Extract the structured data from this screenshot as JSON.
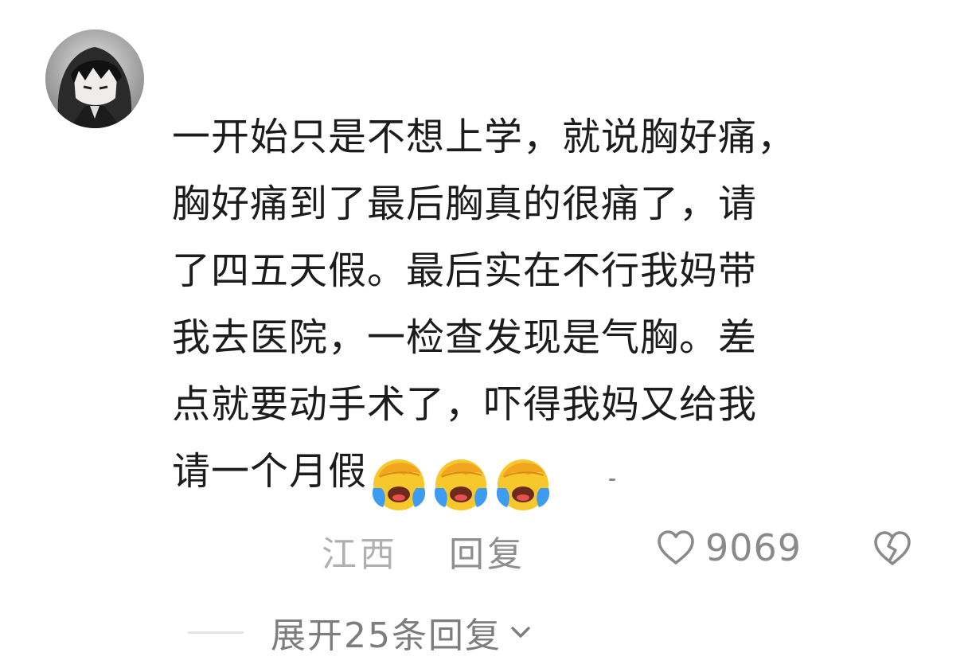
{
  "comment": {
    "lines": [
      "一开始只是不想上学，就说胸好痛，",
      "胸好痛到了最后胸真的很痛了，请",
      "了四五天假。最后实在不行我妈带",
      "我去医院，一检查发现是气胸。差",
      "点就要动手术了，吓得我妈又给我",
      "请一个月假"
    ],
    "emoji": [
      "face-palm-crying-emoji",
      "face-palm-crying-emoji",
      "face-palm-crying-emoji"
    ]
  },
  "meta": {
    "location": "江西",
    "reply_label": "回复",
    "like_count": "9069"
  },
  "expand": {
    "label": "展开25条回复"
  },
  "icons": {
    "like": "heart-outline-icon",
    "dislike": "broken-heart-icon",
    "expand": "chevron-down-icon"
  },
  "colors": {
    "text": "#1c1c1c",
    "muted": "#8a8a8a",
    "location": "#b0b0b0",
    "emoji_face": "#f7c82c",
    "emoji_tears": "#3d9bf0"
  }
}
